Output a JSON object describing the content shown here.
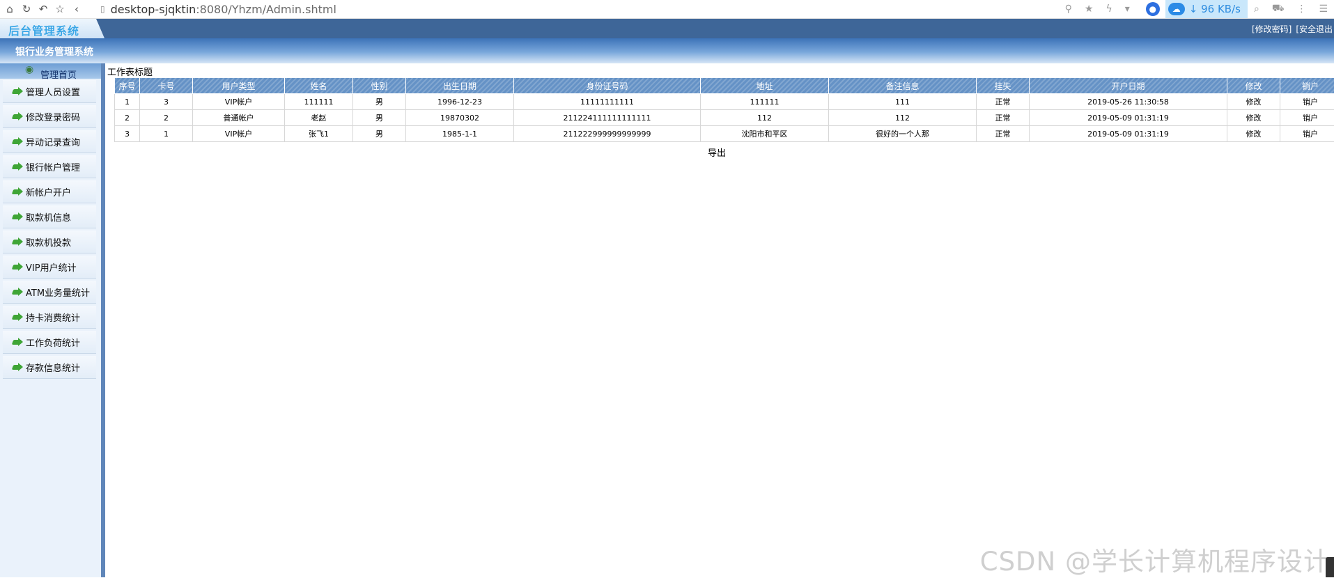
{
  "browser": {
    "url_host": "desktop-sjqktin",
    "url_rest": ":8080/Yhzm/Admin.shtml",
    "speed": "96 KB/s"
  },
  "header": {
    "logo": "后台管理系统",
    "links": [
      "[修改密码]",
      "[安全退出"
    ],
    "system_name": "银行业务管理系统"
  },
  "sidebar": {
    "home_label": "管理首页",
    "items": [
      {
        "label": "管理人员设置"
      },
      {
        "label": "修改登录密码"
      },
      {
        "label": "异动记录查询"
      },
      {
        "label": "银行帐户管理"
      },
      {
        "label": "新帐户开户"
      },
      {
        "label": "取款机信息"
      },
      {
        "label": "取款机投款"
      },
      {
        "label": "VIP用户统计"
      },
      {
        "label": "ATM业务量统计"
      },
      {
        "label": "持卡消费统计"
      },
      {
        "label": "工作负荷统计"
      },
      {
        "label": "存款信息统计"
      }
    ]
  },
  "main": {
    "title": "工作表标题",
    "columns": [
      "序号",
      "卡号",
      "用户类型",
      "姓名",
      "性别",
      "出生日期",
      "身份证号码",
      "地址",
      "备注信息",
      "挂失",
      "开户日期",
      "修改",
      "销户"
    ],
    "rows": [
      [
        "1",
        "3",
        "VIP帐户",
        "111111",
        "男",
        "1996-12-23",
        "11111111111",
        "111111",
        "111",
        "正常",
        "2019-05-26 11:30:58",
        "修改",
        "销户"
      ],
      [
        "2",
        "2",
        "普通帐户",
        "老赵",
        "男",
        "19870302",
        "211224111111111111",
        "112",
        "112",
        "正常",
        "2019-05-09 01:31:19",
        "修改",
        "销户"
      ],
      [
        "3",
        "1",
        "VIP帐户",
        "张飞1",
        "男",
        "1985-1-1",
        "211222999999999999",
        "沈阳市和平区",
        "很好的一个人那",
        "正常",
        "2019-05-09 01:31:19",
        "修改",
        "销户"
      ]
    ],
    "export_label": "导出"
  },
  "watermark": "CSDN @学长计算机程序设计"
}
